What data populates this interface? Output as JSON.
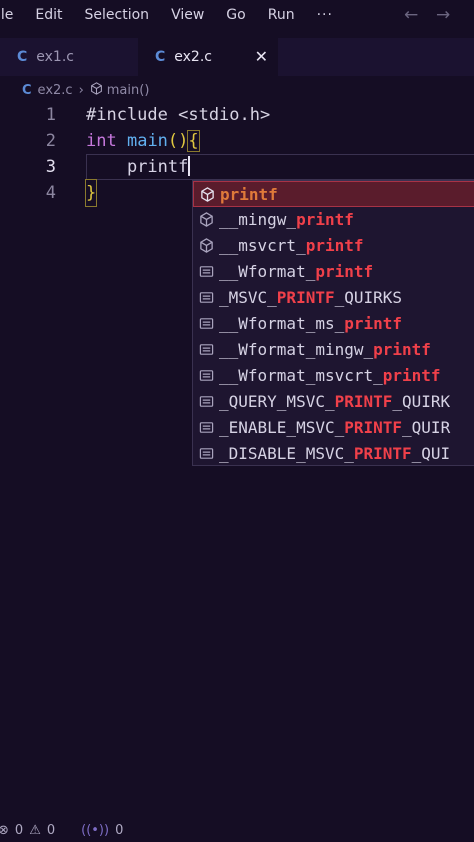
{
  "menu": {
    "items": [
      "ile",
      "Edit",
      "Selection",
      "View",
      "Go",
      "Run"
    ],
    "more": "···",
    "back_icon": "arrow-left",
    "forward_icon": "arrow-right"
  },
  "tabs": [
    {
      "icon": "C",
      "label": "ex1.c"
    },
    {
      "icon": "C",
      "label": "ex2.c",
      "close": "✕"
    }
  ],
  "breadcrumb": {
    "file": "ex2.c",
    "symbol": "main()"
  },
  "code": {
    "line_numbers": [
      "1",
      "2",
      "3",
      "4"
    ],
    "line1": "#include <stdio.h>",
    "line2_kw": "int",
    "line2_fn": "main",
    "line2_parens": "()",
    "line2_brace": "{",
    "line3_text": "printf",
    "line4_brace": "}"
  },
  "suggestions": [
    {
      "icon": "cube",
      "pre": "",
      "match": "printf",
      "post": ""
    },
    {
      "icon": "cube",
      "pre": "__mingw_",
      "match": "printf",
      "post": ""
    },
    {
      "icon": "cube",
      "pre": "__msvcrt_",
      "match": "printf",
      "post": ""
    },
    {
      "icon": "list",
      "pre": "__Wformat_",
      "match": "printf",
      "post": ""
    },
    {
      "icon": "list",
      "pre": "_MSVC_",
      "match": "PRINTF",
      "post": "_QUIRKS"
    },
    {
      "icon": "list",
      "pre": "__Wformat_ms_",
      "match": "printf",
      "post": ""
    },
    {
      "icon": "list",
      "pre": "__Wformat_mingw_",
      "match": "printf",
      "post": ""
    },
    {
      "icon": "list",
      "pre": "__Wformat_msvcrt_",
      "match": "printf",
      "post": ""
    },
    {
      "icon": "list",
      "pre": "_QUERY_MSVC_",
      "match": "PRINTF",
      "post": "_QUIRK"
    },
    {
      "icon": "list",
      "pre": "_ENABLE_MSVC_",
      "match": "PRINTF",
      "post": "_QUIR"
    },
    {
      "icon": "list",
      "pre": "_DISABLE_MSVC_",
      "match": "PRINTF",
      "post": "_QUI"
    }
  ],
  "status": {
    "errors": "0",
    "warnings": "0",
    "ports": "0"
  }
}
